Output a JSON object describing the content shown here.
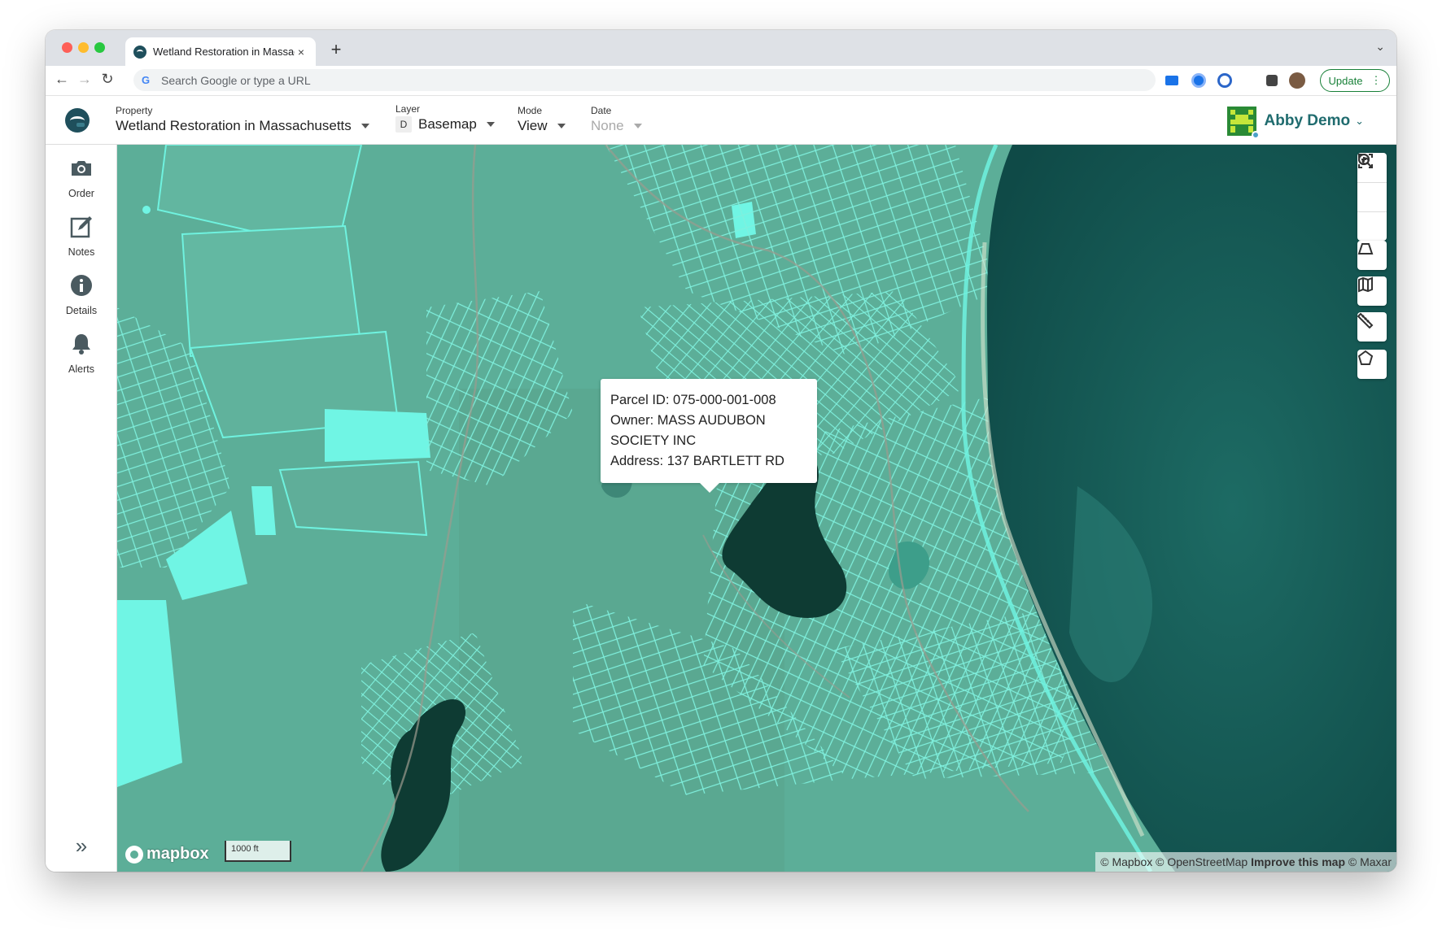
{
  "browser": {
    "tab_title": "Wetland Restoration in Massac",
    "tab_close": "×",
    "new_tab": "+",
    "tab_menu": "⌄",
    "omnibox_placeholder": "Search Google or type a URL",
    "google_letter": "G",
    "update_label": "Update",
    "update_menu": "⋮",
    "nav_back": "←",
    "nav_forward": "→",
    "nav_reload": "↻"
  },
  "header": {
    "property_label": "Property",
    "property_value": "Wetland Restoration in Massachusetts",
    "layer_label": "Layer",
    "layer_badge": "D",
    "layer_value": "Basemap",
    "mode_label": "Mode",
    "mode_value": "View",
    "date_label": "Date",
    "date_value": "None",
    "user_name": "Abby Demo",
    "user_chevron": "⌄"
  },
  "sidebar": {
    "items": [
      {
        "label": "Order",
        "icon": "camera-icon"
      },
      {
        "label": "Notes",
        "icon": "edit-icon"
      },
      {
        "label": "Details",
        "icon": "info-icon"
      },
      {
        "label": "Alerts",
        "icon": "bell-icon"
      }
    ],
    "expand": "»"
  },
  "map": {
    "popup": {
      "parcel": "Parcel ID: 075-000-001-008",
      "owner_line1": "Owner: MASS AUDUBON",
      "owner_line2": "SOCIETY INC",
      "address": "Address: 137 BARTLETT RD"
    },
    "brand": "mapbox",
    "scale": "1000 ft",
    "attribution_left": "© Mapbox © OpenStreetMap",
    "attribution_bold": "Improve this map",
    "attribution_right": "© Maxar",
    "tools": [
      "zoom-in-icon",
      "zoom-out-icon",
      "fit-extent-icon",
      "trapezoid-icon",
      "map-icon",
      "ruler-icon",
      "polygon-icon"
    ],
    "colors": {
      "land": "#5cae98",
      "parcel_line": "#6ff2df",
      "water": "#0e3b33",
      "ocean": "#1e6f66"
    }
  }
}
